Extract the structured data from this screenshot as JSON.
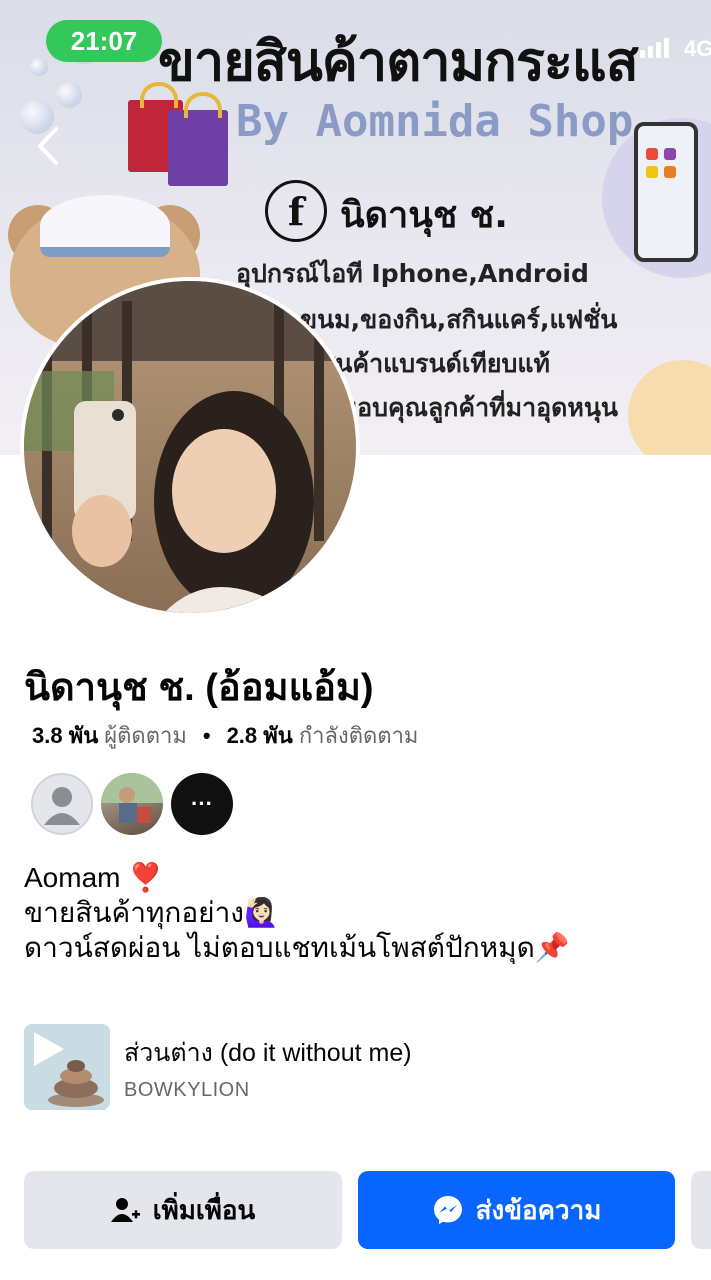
{
  "status_bar": {
    "time": "21:07",
    "network": "4G"
  },
  "cover": {
    "title": "ขายสินค้าตามกระแส",
    "subtitle": "By Aomnida Shop",
    "fb_letter": "f",
    "fb_name": "นิดานุช ช.",
    "lines": [
      "อุปกรณ์ไอที Iphone,Android",
      "ขนม,ของกิน,สกินแคร์,แฟชั่น",
      "สินค้าแบรนด์เทียบแท้",
      "ขอบคุณลูกค้าที่มาอุดหนุน"
    ]
  },
  "profile": {
    "name": "นิดานุช ช. (อ้อมแอ้ม)",
    "followers_count": "3.8 พัน",
    "followers_label": "ผู้ติดตาม",
    "separator": "•",
    "following_count": "2.8 พัน",
    "following_label": "กำลังติดตาม",
    "mutual_more": "···"
  },
  "bio": {
    "line1": "Aomam ❣️",
    "line2": "ขายสินค้าทุกอย่าง🙋🏻‍♀️",
    "line3": "ดาวน์สดผ่อน ไม่ตอบแชทเม้นโพสต์ปักหมุด📌"
  },
  "music": {
    "title": "ส่วนต่าง (do it without me)",
    "artist": "BOWKYLION"
  },
  "actions": {
    "add_friend": "เพิ่มเพื่อน",
    "message": "ส่งข้อความ"
  },
  "colors": {
    "primary": "#0866ff",
    "secondary_button": "#e4e6eb",
    "muted_text": "#65676b",
    "status_pill": "#34c759"
  },
  "icons": {
    "back": "chevron-left-icon",
    "add_friend": "person-add-icon",
    "message": "messenger-icon",
    "play": "play-icon"
  }
}
